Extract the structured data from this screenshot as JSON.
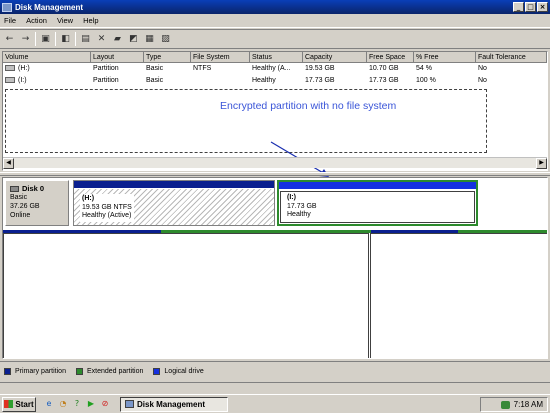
{
  "window": {
    "title": "Disk Management",
    "min": "_",
    "max": "□",
    "close": "×"
  },
  "menu": [
    "File",
    "Action",
    "View",
    "Help"
  ],
  "toolbar_icons": [
    "back-icon",
    "forward-icon",
    "console-icon",
    "properties-icon",
    "help-icon",
    "delete-icon",
    "open-icon",
    "explore-icon",
    "properties2-icon",
    "refresh-icon"
  ],
  "volume_list": {
    "headers": [
      "Volume",
      "Layout",
      "Type",
      "File System",
      "Status",
      "Capacity",
      "Free Space",
      "% Free",
      "Fault Tolerance"
    ],
    "rows": [
      [
        "(H:)",
        "Partition",
        "Basic",
        "NTFS",
        "Healthy (A...",
        "19.53 GB",
        "10.70 GB",
        "54 %",
        "No"
      ],
      [
        "(I:)",
        "Partition",
        "Basic",
        "",
        "Healthy",
        "17.73 GB",
        "17.73 GB",
        "100 %",
        "No"
      ]
    ]
  },
  "callout": {
    "text": "Encrypted partition with no file system",
    "color": "#3a55d8"
  },
  "disk": {
    "name": "Disk 0",
    "type": "Basic",
    "size": "37.26 GB",
    "status": "Online",
    "partitions": [
      {
        "name": "(H:)",
        "size": "19.53 GB NTFS",
        "status": "Healthy (Active)"
      },
      {
        "name": "(I:)",
        "size": "17.73 GB",
        "status": "Healthy"
      }
    ]
  },
  "legend": [
    {
      "label": "Primary partition",
      "color": "#0a1f8f"
    },
    {
      "label": "Extended partition",
      "color": "#2d8a2d"
    },
    {
      "label": "Logical drive",
      "color": "#1530e0"
    }
  ],
  "taskbar": {
    "start": "Start",
    "task": "Disk Management",
    "time": "7:18 AM"
  }
}
